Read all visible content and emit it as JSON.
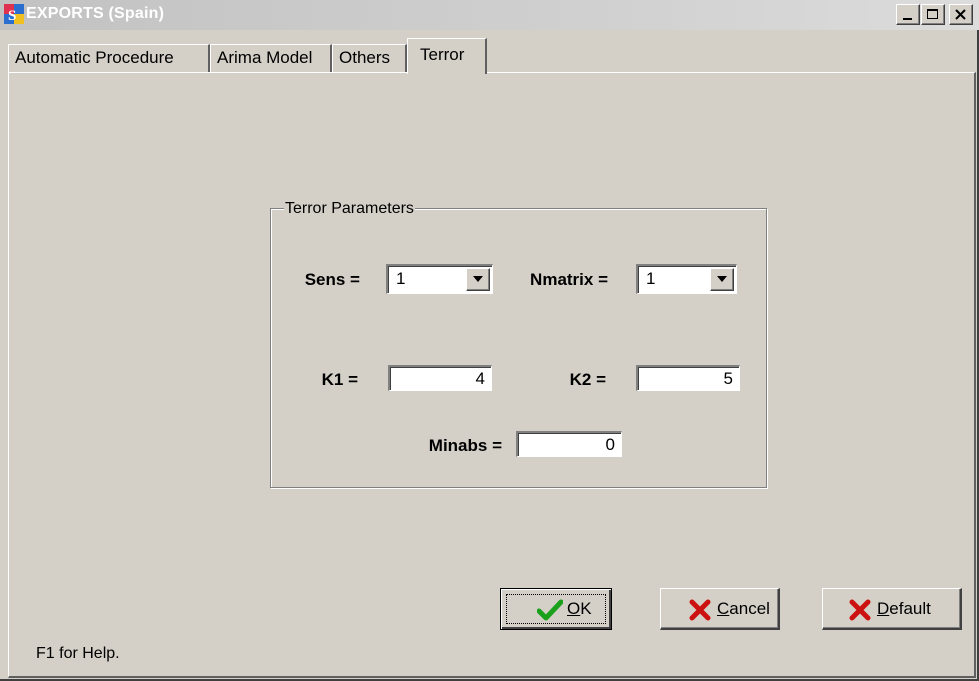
{
  "window": {
    "title": "EXPORTS (Spain)",
    "controls": [
      "minimize-icon",
      "maximize-icon",
      "close-icon"
    ]
  },
  "tabs": [
    {
      "label": "Automatic Procedure",
      "active": false
    },
    {
      "label": "Arima Model",
      "active": false
    },
    {
      "label": "Others",
      "active": false
    },
    {
      "label": "Terror",
      "active": true
    }
  ],
  "group": {
    "title": "Terror Parameters",
    "sens": {
      "label": "Sens =",
      "value": "1"
    },
    "nmatrix": {
      "label": "Nmatrix =",
      "value": "1"
    },
    "k1": {
      "label": "K1 =",
      "value": "4"
    },
    "k2": {
      "label": "K2 =",
      "value": "5"
    },
    "minabs": {
      "label": "Minabs =",
      "value": "0"
    }
  },
  "buttons": {
    "ok": {
      "mnemonic": "O",
      "rest": "K",
      "icon": "check-icon"
    },
    "cancel": {
      "mnemonic": "C",
      "rest": "ancel",
      "icon": "x-icon"
    },
    "default": {
      "mnemonic": "D",
      "rest": "efault",
      "icon": "x-icon"
    }
  },
  "status": {
    "help": "F1 for Help."
  },
  "colors": {
    "face": "#d4d0c8",
    "check": "#1aa01a",
    "x": "#cc1111"
  }
}
